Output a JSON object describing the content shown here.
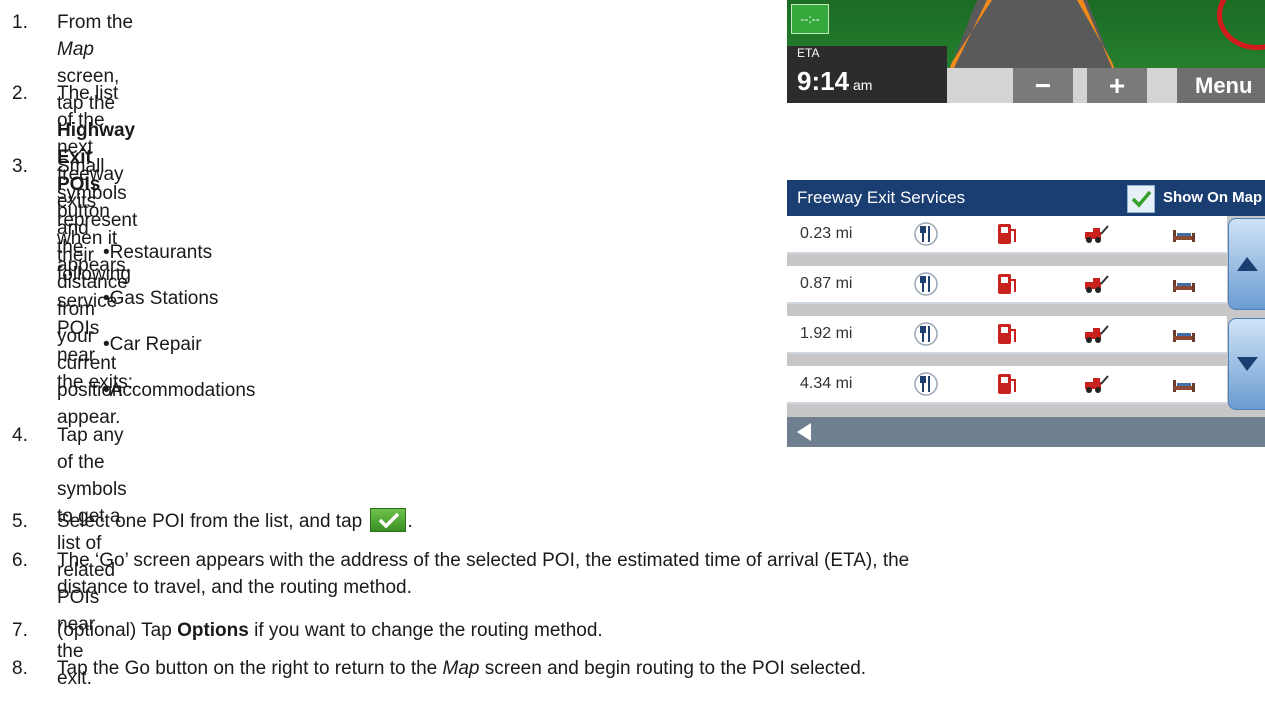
{
  "steps": [
    {
      "num": "1.",
      "pre": "From the ",
      "em": "Map",
      "mid": " screen, tap the ",
      "strong": "Highway Exit POIs",
      "post": " button",
      "line2": "when it appears."
    },
    {
      "num": "2.",
      "text": "The list of the next freeway exits and their distance from",
      "line2": "your current position appear."
    },
    {
      "num": "3.",
      "text": "Small symbols represent the following service POIs near",
      "line2": "the exits:"
    },
    {
      "num": "4.",
      "text": "Tap any of the symbols to get a list of related POIs near the",
      "line2": "exit."
    },
    {
      "num": "5.",
      "pre": "Select one POI from the list, and tap",
      "post": "."
    },
    {
      "num": "6.",
      "text": "The ‘Go’ screen appears with the address of the selected POI, the estimated time of arrival (ETA), the",
      "line2": "distance to travel, and the routing method."
    },
    {
      "num": "7.",
      "pre": "(optional) Tap ",
      "strong": "Options",
      "post": " if you want to change the routing method."
    },
    {
      "num": "8.",
      "pre": "Tap the Go button on the right to return to the ",
      "em": "Map",
      "post": " screen and begin routing to the POI selected."
    }
  ],
  "bullets": [
    "•Restaurants",
    "•Gas Stations",
    "•Car Repair",
    "•Accommodations"
  ],
  "map": {
    "chip": "--:--",
    "eta_label": "ETA",
    "eta_time": "9:14",
    "eta_suffix": "am",
    "zoom_out": "−",
    "zoom_in": "+",
    "menu": "Menu"
  },
  "panel": {
    "title": "Freeway Exit Services",
    "show_on_map": "Show On Map",
    "rows": [
      {
        "distance": "0.23 mi"
      },
      {
        "distance": "0.87 mi"
      },
      {
        "distance": "1.92 mi"
      },
      {
        "distance": "4.34 mi"
      }
    ],
    "icons": [
      "restaurant-icon",
      "gas-station-icon",
      "tow-truck-icon",
      "bed-icon"
    ]
  },
  "colors": {
    "accent_green": "#3a8f23",
    "header_blue": "#1b3e72",
    "alert_red": "#d41b1b"
  }
}
